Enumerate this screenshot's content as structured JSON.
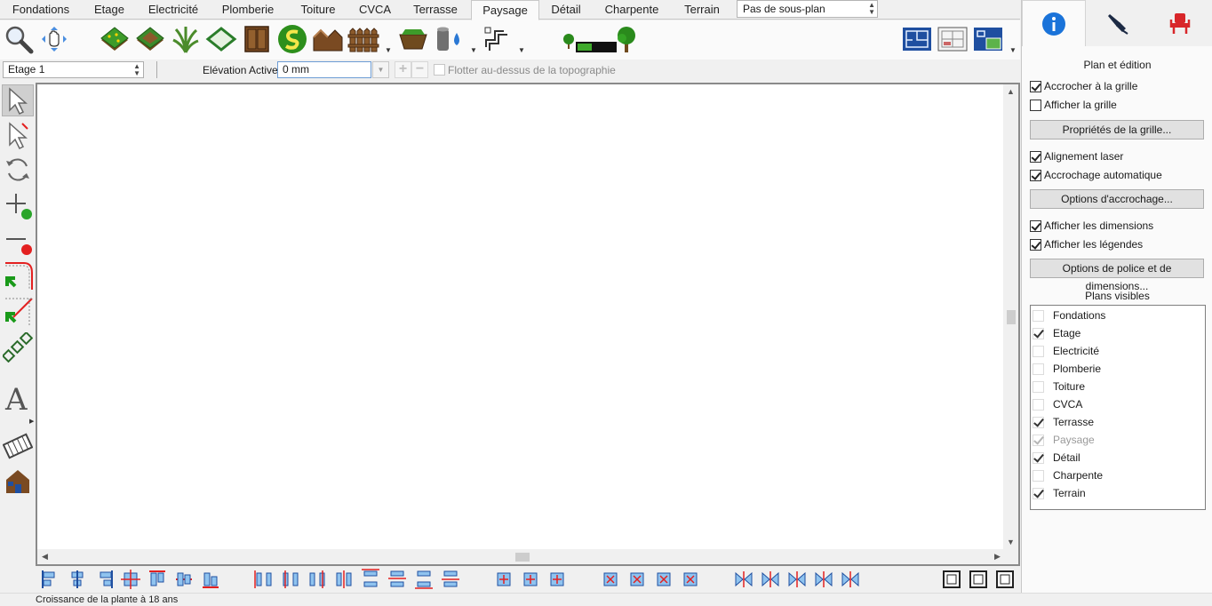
{
  "tabs": [
    "Fondations",
    "Etage",
    "Electricité",
    "Plomberie",
    "Toiture",
    "CVCA",
    "Terrasse",
    "Paysage",
    "Détail",
    "Charpente",
    "Terrain"
  ],
  "active_tab": "Paysage",
  "subplan": {
    "value": "Pas de sous-plan"
  },
  "options_bar": {
    "floor_select": "Etage 1",
    "elevation_label": "Elévation Active:",
    "elevation_value": "0 mm",
    "float_label": "Flotter au-dessus de la topographie"
  },
  "toolbar_icons": [
    "zoom-magnifier-icon",
    "pan-hand-icon",
    "grass-plot-icon",
    "terrain-patch-icon",
    "plant-grass-icon",
    "plot-outline-icon",
    "cabinet-icon",
    "path-s-icon",
    "hip-roof-icon",
    "fence-icon",
    "planter-box-icon",
    "water-tank-icon",
    "path-tool-icon",
    "plant-growth-slider-icon",
    "tree-icon",
    "plan-view-icon",
    "elevation-view-icon",
    "camera-view-icon"
  ],
  "left_tools": [
    "select-arrow-icon",
    "select-edit-arrow-icon",
    "rotate-icon",
    "add-point-icon",
    "remove-point-icon",
    "break-line-icon",
    "join-line-icon",
    "chain-icon",
    "text-icon",
    "film-icon",
    "house-view-icon"
  ],
  "bottom_tools": [
    "align-left-icon",
    "align-center-h-icon",
    "align-right-icon",
    "center-icon",
    "align-top-icon",
    "align-middle-v-icon",
    "align-bottom-icon",
    "distribute-left-icon",
    "distribute-center-icon",
    "distribute-right-icon",
    "distribute-h-icon",
    "distribute-top-icon",
    "distribute-middle-icon",
    "distribute-bottom-icon",
    "distribute-v-icon",
    "match-width-icon",
    "match-height-icon",
    "match-size-icon",
    "resize-icon",
    "box-x-icon",
    "box-plus-icon",
    "box-expand-icon",
    "copy-icon",
    "flip-h-icon",
    "flip-v-icon",
    "mirror-h-icon",
    "mirror-v-icon",
    "frame-icon",
    "frame-plus-icon",
    "frame-corner-icon"
  ],
  "status": "Croissance de la plante à 18 ans",
  "panel": {
    "tabs": [
      "info-icon",
      "pen-nib-icon",
      "chair-icon"
    ],
    "section_title": "Plan et édition",
    "snap_grid": {
      "label": "Accrocher à la grille",
      "checked": true
    },
    "show_grid": {
      "label": "Afficher la grille",
      "checked": false
    },
    "grid_props_btn": "Propriétés de la grille...",
    "laser": {
      "label": "Alignement laser",
      "checked": true
    },
    "auto_snap": {
      "label": "Accrochage automatique",
      "checked": true
    },
    "snap_options_btn": "Options d'accrochage...",
    "show_dims": {
      "label": "Afficher les dimensions",
      "checked": true
    },
    "show_legends": {
      "label": "Afficher les légendes",
      "checked": true
    },
    "font_dims_btn": "Options de police et de dimensions...",
    "visible_title": "Plans visibles",
    "plans": [
      {
        "label": "Fondations",
        "checked": false
      },
      {
        "label": "Etage",
        "checked": true
      },
      {
        "label": "Electricité",
        "checked": false
      },
      {
        "label": "Plomberie",
        "checked": false
      },
      {
        "label": "Toiture",
        "checked": false
      },
      {
        "label": "CVCA",
        "checked": false
      },
      {
        "label": "Terrasse",
        "checked": true
      },
      {
        "label": "Paysage",
        "checked": true,
        "disabled": true
      },
      {
        "label": "Détail",
        "checked": true
      },
      {
        "label": "Charpente",
        "checked": false
      },
      {
        "label": "Terrain",
        "checked": true
      }
    ]
  },
  "colors": {
    "accent": "#1a73d9",
    "green": "#2aa52a",
    "red": "#e32020",
    "blueprint": "#1f4fa0"
  }
}
